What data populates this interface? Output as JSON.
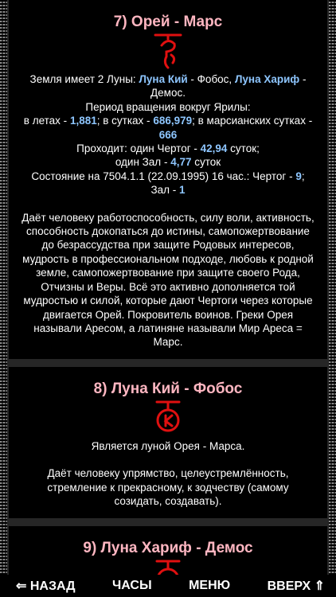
{
  "sections": [
    {
      "title": "7) Орей - Марс",
      "moons_prefix": "Земля имеет 2 Луны: ",
      "moon1": "Луна Кий",
      "moons_mid": " - Фобос, ",
      "moon2": "Луна Хариф",
      "moons_suffix": " - Демос.",
      "period_title": "Период вращения вокруг Ярилы:",
      "years_label": "в летах - ",
      "years_value": "1,881",
      "days_label": "; в сутках - ",
      "days_value": "686,979",
      "mars_days_label": "; в марсианских сутках - ",
      "mars_days_value": "666",
      "chertog_label": "Проходит: один Чертог - ",
      "chertog_value": "42,94",
      "chertog_suffix": " суток;",
      "hall_label": "один Зал - ",
      "hall_value": "4,77",
      "hall_suffix": " суток",
      "state_label": "Состояние на 7504.1.1 (22.09.1995) 16 час.: Чертог - ",
      "state_chertog": "9",
      "state_mid": ";",
      "state_hall_label": "Зал - ",
      "state_hall": "1",
      "description": "Даёт человеку работоспособность, силу воли, активность, способность докопаться до истины, самопожертвование до безрассудства при защите Родовых интересов, мудрость в профессиональном подходе, любовь к родной земле, самопожертвование при защите своего Рода, Отчизны и Веры. Всё это активно дополняется той мудростью и силой, которые дают Чертоги через которые двигается Орей. Покровитель воинов. Греки Орея называли Аресом, а латиняне называли Мир Ареса = Марс."
    },
    {
      "title": "8) Луна Кий - Фобос",
      "line1": "Является луной Орея - Марса.",
      "description": "Даёт человеку упрямство, целеустремлённость, стремление к прекрасному, к зодчеству (самому созидать, создавать)."
    },
    {
      "title": "9) Луна Хариф - Демос"
    }
  ],
  "nav": {
    "back": "⇐ НАЗАД",
    "clock": "ЧАСЫ",
    "menu": "МЕНЮ",
    "up": "ВВЕРХ ⇑"
  },
  "colors": {
    "title": "#ffb6c1",
    "value": "#8ec6ff",
    "symbol": "#e01010"
  }
}
